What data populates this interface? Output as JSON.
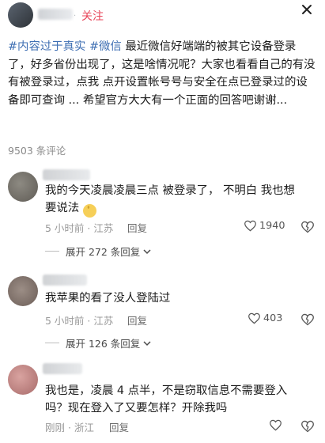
{
  "header": {
    "follow_label": "关注",
    "dot": "·"
  },
  "post": {
    "tags": [
      "#内容过于真实",
      "#微信"
    ],
    "text": " 最近微信好端端的被其它设备登录了，好多省份出现了，这是啥情况呢？大家也看看自己的有没有被登录过，点我 点开设置帐号号与安全在点已登录过的设备即可查询 ... 希望官方大大有一个正面的回答吧谢谢..."
  },
  "comments_count": "9503 条评论",
  "comments": [
    {
      "text": "我的今天凌晨凌晨三点 被登录了，    不明白 我也想要说法",
      "time": "5 小时前 · 江苏",
      "reply": "回复",
      "likes": "1940",
      "expand": "展开 272 条回复"
    },
    {
      "text": "我苹果的看了没人登陆过",
      "time": "5 小时前 · 江苏",
      "reply": "回复",
      "likes": "403",
      "expand": "展开 126 条回复"
    },
    {
      "text": "我也是，凌晨 4 点半，不是窃取信息不需要登入吗？现在登入了又要怎样？开除我吗",
      "time": "刚刚 · 浙江",
      "reply": "回复",
      "likes": "",
      "expand": ""
    }
  ],
  "colors": {
    "accent": "#e8465a",
    "tag": "#3f6fb3"
  }
}
